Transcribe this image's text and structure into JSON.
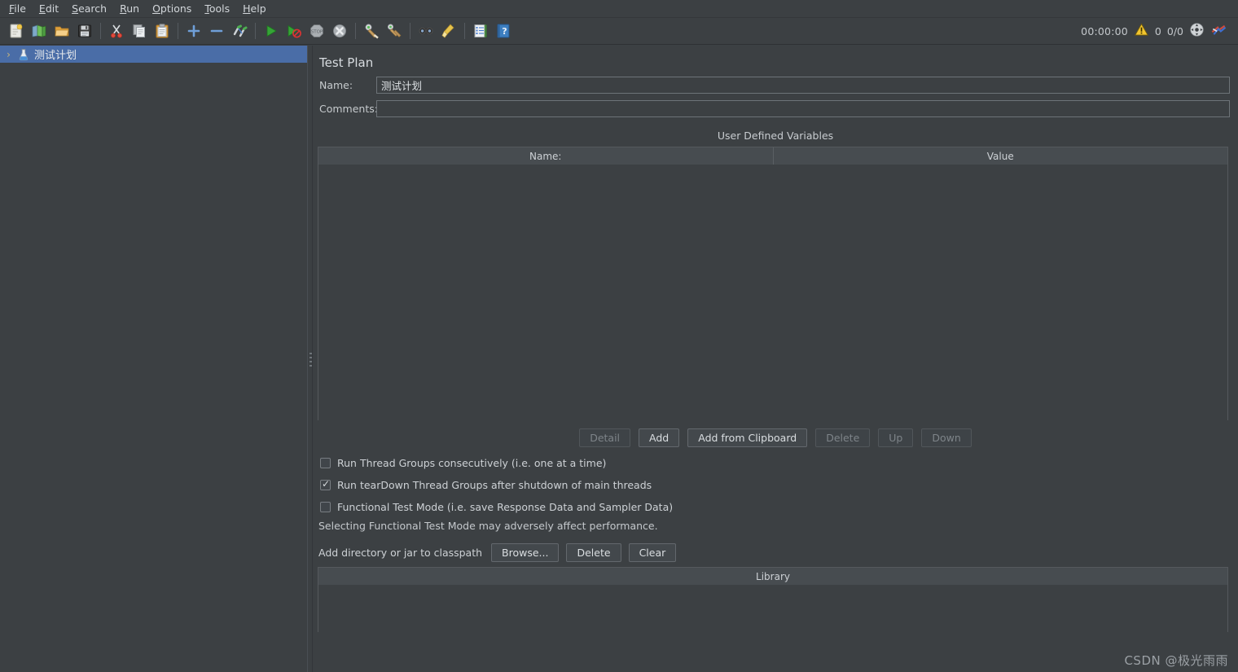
{
  "menubar": {
    "items": [
      {
        "label": "File",
        "mnemonic": "F"
      },
      {
        "label": "Edit",
        "mnemonic": "E"
      },
      {
        "label": "Search",
        "mnemonic": "S"
      },
      {
        "label": "Run",
        "mnemonic": "R"
      },
      {
        "label": "Options",
        "mnemonic": "O"
      },
      {
        "label": "Tools",
        "mnemonic": "T"
      },
      {
        "label": "Help",
        "mnemonic": "H"
      }
    ]
  },
  "toolbar": {
    "buttons": [
      {
        "name": "new-icon",
        "title": "New"
      },
      {
        "name": "templates-icon",
        "title": "Templates"
      },
      {
        "name": "open-icon",
        "title": "Open"
      },
      {
        "name": "save-icon",
        "title": "Save Test Plan"
      },
      {
        "name": "cut-icon",
        "title": "Cut"
      },
      {
        "name": "copy-icon",
        "title": "Copy"
      },
      {
        "name": "paste-icon",
        "title": "Paste"
      },
      {
        "name": "expand-all-icon",
        "title": "Expand All"
      },
      {
        "name": "collapse-all-icon",
        "title": "Collapse All"
      },
      {
        "name": "toggle-icon",
        "title": "Toggle"
      },
      {
        "name": "start-icon",
        "title": "Start"
      },
      {
        "name": "start-no-pauses-icon",
        "title": "Start no pauses"
      },
      {
        "name": "stop-icon",
        "title": "Stop"
      },
      {
        "name": "shutdown-icon",
        "title": "Shutdown"
      },
      {
        "name": "clear-icon",
        "title": "Clear"
      },
      {
        "name": "clear-all-icon",
        "title": "Clear All"
      },
      {
        "name": "search-icon",
        "title": "Search"
      },
      {
        "name": "reset-search-icon",
        "title": "Reset Search"
      },
      {
        "name": "function-helper-icon",
        "title": "Function Helper Dialog"
      },
      {
        "name": "help-icon",
        "title": "Help"
      }
    ],
    "status": {
      "elapsed": "00:00:00",
      "warning_count": "0",
      "threads": "0/0",
      "warning_icon": "warning-triangle-icon",
      "remote_icon": "remote-engines-icon",
      "theme_icon": "jmeter-logo-icon"
    }
  },
  "tree": {
    "items": [
      {
        "label": "测试计划",
        "icon": "test-plan-icon",
        "chevron": "›",
        "selected": true
      }
    ]
  },
  "main": {
    "title": "Test Plan",
    "name_label": "Name:",
    "name_value": "测试计划",
    "comments_label": "Comments:",
    "comments_value": "",
    "udv_section_title": "User Defined Variables",
    "udv_table": {
      "columns": [
        "Name:",
        "Value"
      ],
      "rows": []
    },
    "udv_buttons": [
      {
        "label": "Detail",
        "enabled": false
      },
      {
        "label": "Add",
        "enabled": true
      },
      {
        "label": "Add from Clipboard",
        "enabled": true
      },
      {
        "label": "Delete",
        "enabled": false
      },
      {
        "label": "Up",
        "enabled": false
      },
      {
        "label": "Down",
        "enabled": false
      }
    ],
    "checkboxes": [
      {
        "label": "Run Thread Groups consecutively (i.e. one at a time)",
        "checked": false
      },
      {
        "label": "Run tearDown Thread Groups after shutdown of main threads",
        "checked": true
      },
      {
        "label": "Functional Test Mode (i.e. save Response Data and Sampler Data)",
        "checked": false
      }
    ],
    "functional_hint": "Selecting Functional Test Mode may adversely affect performance.",
    "classpath_label": "Add directory or jar to classpath",
    "classpath_buttons": [
      {
        "label": "Browse...",
        "enabled": true
      },
      {
        "label": "Delete",
        "enabled": true
      },
      {
        "label": "Clear",
        "enabled": true
      }
    ],
    "library_table": {
      "columns": [
        "Library"
      ],
      "rows": []
    }
  },
  "watermark": "CSDN @极光雨雨",
  "colors": {
    "background": "#3c4043",
    "panel": "#3c4043",
    "selection": "#4a6da7",
    "table_header": "#474c50",
    "border": "#55595d",
    "text": "#cdd1d5",
    "disabled_text": "#7e8489",
    "accent_green": "#3fa64a",
    "accent_yellow": "#e8c53a"
  }
}
